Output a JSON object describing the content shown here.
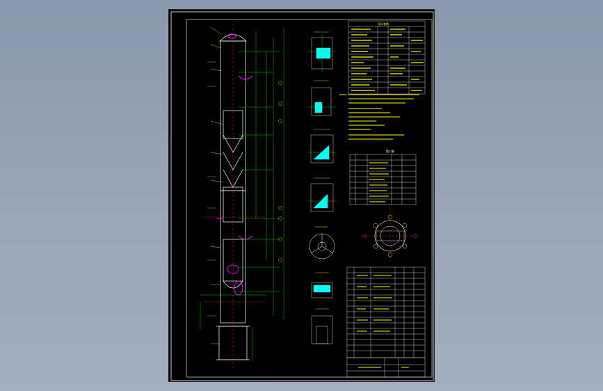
{
  "colors": {
    "background": "#8a98ad",
    "sheet": "#000000",
    "vessel": "#ffffff",
    "dimension": "#00ff00",
    "annotation": "#ffff00",
    "centerline": "#ff0000",
    "detail_fill": "#00ffff",
    "nozzle": "#ff00ff"
  },
  "drawing": {
    "detail_views": 7,
    "table_title": "设计参数",
    "parts_table_title": "管口表"
  }
}
